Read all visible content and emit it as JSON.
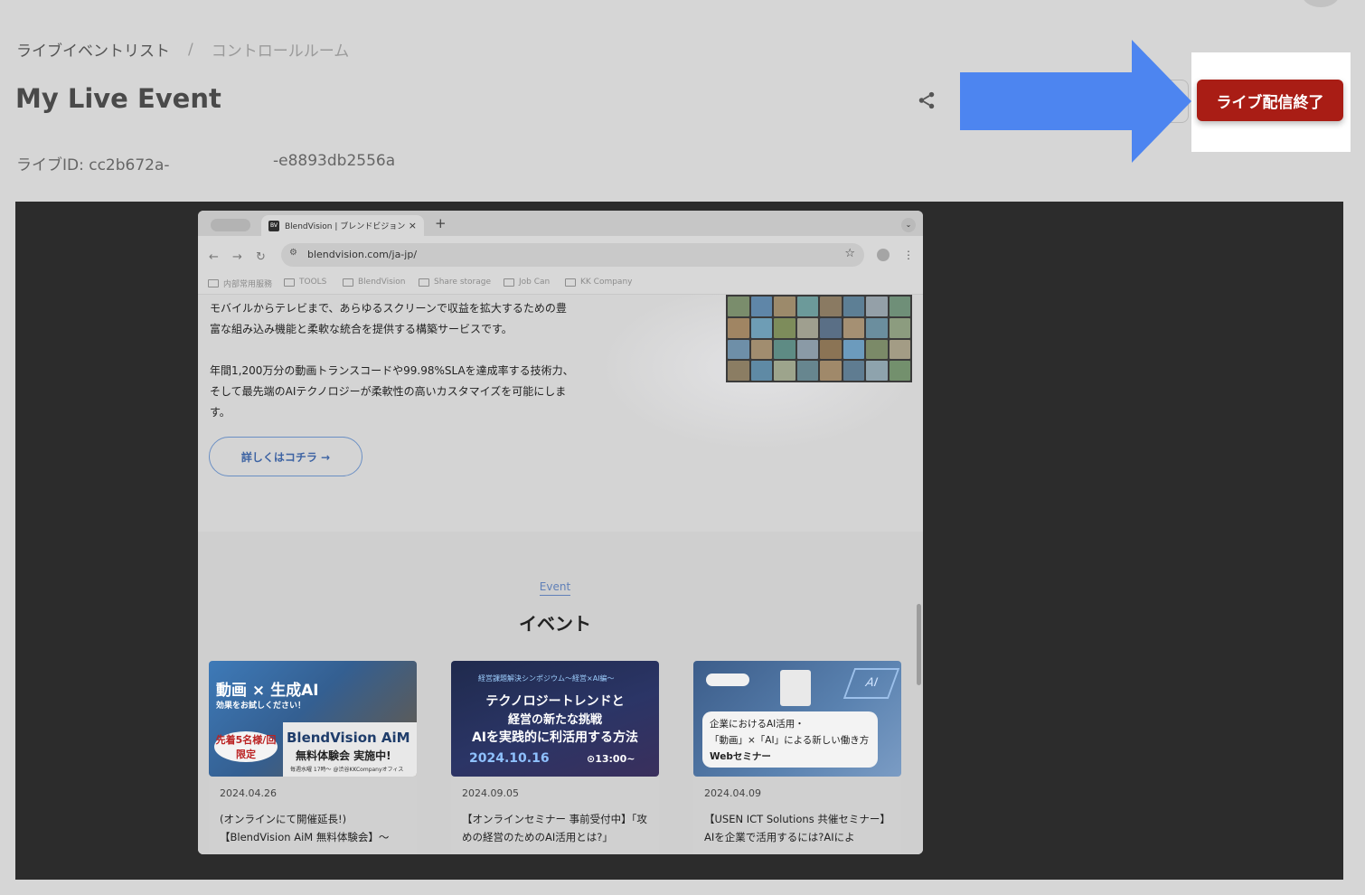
{
  "breadcrumb": {
    "parent": "ライブイベントリスト",
    "separator": "/",
    "current": "コントロールルーム"
  },
  "event": {
    "title": "My Live Event",
    "id_label": "ライブID: cc2b672a-",
    "id_tail": "-e8893db2556a"
  },
  "actions": {
    "end_live_label": "ライブ配信終了",
    "end_live_color": "#a91d15",
    "annotation_arrow_color": "#4d85f0"
  },
  "preview": {
    "browser": {
      "tab_favicon": "BV",
      "tab_title": "BlendVision | ブレンドビジョン",
      "tab_close": "×",
      "new_tab": "+",
      "url": "blendvision.com/ja-jp/",
      "bookmarks": [
        "内部常用服務",
        "TOOLS",
        "BlendVision",
        "Share storage",
        "Job Can",
        "KK Company"
      ]
    },
    "page": {
      "intro_text": "モバイルからテレビまで、あらゆるスクリーンで収益を拡大するための豊富な組み込み機能と柔軟な統合を提供する構築サービスです。",
      "stats_text": "年間1,200万分の動画トランスコードや99.98%SLAを達成率する技術力、そして最先端のAIテクノロジーが柔軟性の高いカスタマイズを可能にします。",
      "more_link": "詳しくはコチラ →",
      "event_label_en": "Event",
      "event_label_ja": "イベント",
      "cards": [
        {
          "date": "2024.04.26",
          "title": "(オンラインにて開催延長!)【BlendVision AiM 無料体験会】〜",
          "image_text": {
            "line1": "動画 × 生成AI",
            "line2": "効果をお試しください！",
            "badge": "先着5名様/回 限定",
            "brand": "BlendVision AiM",
            "cta": "無料体験会 実施中!",
            "note": "毎週水曜 17時〜 @渋谷KKCompanyオフィス"
          }
        },
        {
          "date": "2024.09.05",
          "title": "【オンラインセミナー 事前受付中】「攻めの経営のためのAI活用とは?」",
          "image_text": {
            "top": "経営課題解決シンポジウム〜経営×AI編〜",
            "line1": "テクノロジートレンドと",
            "line2": "経営の新たな挑戦",
            "line3": "AIを実践的に利活用する方法",
            "date": "2024.10.16",
            "time": "⊙13:00~"
          }
        },
        {
          "date": "2024.04.09",
          "title": "【USEN ICT Solutions 共催セミナー】AIを企業で活用するには?AIによ",
          "image_text": {
            "chip": "AI",
            "line1": "企業におけるAI活用・",
            "line2": "「動画」×「AI」による新しい働き方",
            "line3": "Webセミナー"
          }
        }
      ]
    }
  }
}
